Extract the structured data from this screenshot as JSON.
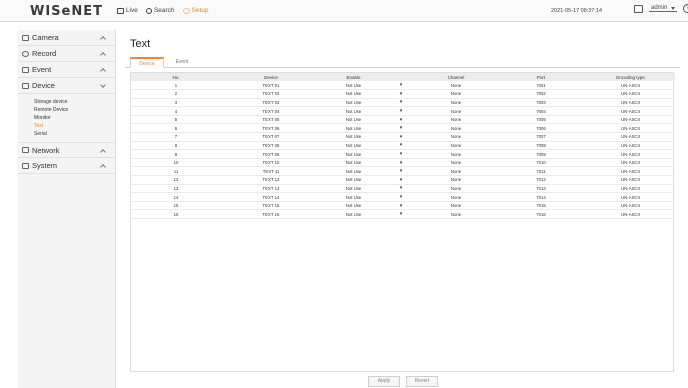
{
  "header": {
    "logo": "WISeNET",
    "nav": [
      {
        "label": "Live",
        "icon": "live-icon"
      },
      {
        "label": "Search",
        "icon": "search-icon"
      },
      {
        "label": "Setup",
        "icon": "setup-icon"
      }
    ],
    "datetime": "2021-05-17 08:37:14",
    "user": "admin",
    "accent": "#e98a2d"
  },
  "sidebar": {
    "camera": "Camera",
    "record": "Record",
    "event": "Event",
    "device": "Device",
    "device_items": [
      "Storage device",
      "Remote Device",
      "Monitor",
      "Text",
      "Serial"
    ],
    "network": "Network",
    "system": "System"
  },
  "main": {
    "title": "Text",
    "tabs": [
      "Device",
      "Event"
    ],
    "columns": [
      "No.",
      "Device",
      "Enable",
      "",
      "Channel",
      "Port",
      "Encoding type"
    ],
    "rows": [
      [
        "1",
        "TEXT 01",
        "Not Use",
        "▾",
        "None",
        "7001",
        "UN-ASCII"
      ],
      [
        "2",
        "TEXT 02",
        "Not Use",
        "▾",
        "None",
        "7002",
        "UN-ASCII"
      ],
      [
        "3",
        "TEXT 03",
        "Not Use",
        "▾",
        "None",
        "7003",
        "UN-ASCII"
      ],
      [
        "4",
        "TEXT 04",
        "Not Use",
        "▾",
        "None",
        "7004",
        "UN-ASCII"
      ],
      [
        "5",
        "TEXT 05",
        "Not Use",
        "▾",
        "None",
        "7005",
        "UN-ASCII"
      ],
      [
        "6",
        "TEXT 06",
        "Not Use",
        "▾",
        "None",
        "7006",
        "UN-ASCII"
      ],
      [
        "7",
        "TEXT 07",
        "Not Use",
        "▾",
        "None",
        "7007",
        "UN-ASCII"
      ],
      [
        "8",
        "TEXT 08",
        "Not Use",
        "▾",
        "None",
        "7008",
        "UN-ASCII"
      ],
      [
        "9",
        "TEXT 09",
        "Not Use",
        "▾",
        "None",
        "7009",
        "UN-ASCII"
      ],
      [
        "10",
        "TEXT 10",
        "Not Use",
        "▾",
        "None",
        "7010",
        "UN-ASCII"
      ],
      [
        "11",
        "TEXT 11",
        "Not Use",
        "▾",
        "None",
        "7011",
        "UN-ASCII"
      ],
      [
        "12",
        "TEXT 12",
        "Not Use",
        "▾",
        "None",
        "7012",
        "UN-ASCII"
      ],
      [
        "13",
        "TEXT 13",
        "Not Use",
        "▾",
        "None",
        "7013",
        "UN-ASCII"
      ],
      [
        "14",
        "TEXT 14",
        "Not Use",
        "▾",
        "None",
        "7014",
        "UN-ASCII"
      ],
      [
        "15",
        "TEXT 15",
        "Not Use",
        "▾",
        "None",
        "7015",
        "UN-ASCII"
      ],
      [
        "16",
        "TEXT 16",
        "Not Use",
        "▾",
        "None",
        "7016",
        "UN-ASCII"
      ]
    ],
    "apply": "Apply",
    "revert": "Revert"
  }
}
